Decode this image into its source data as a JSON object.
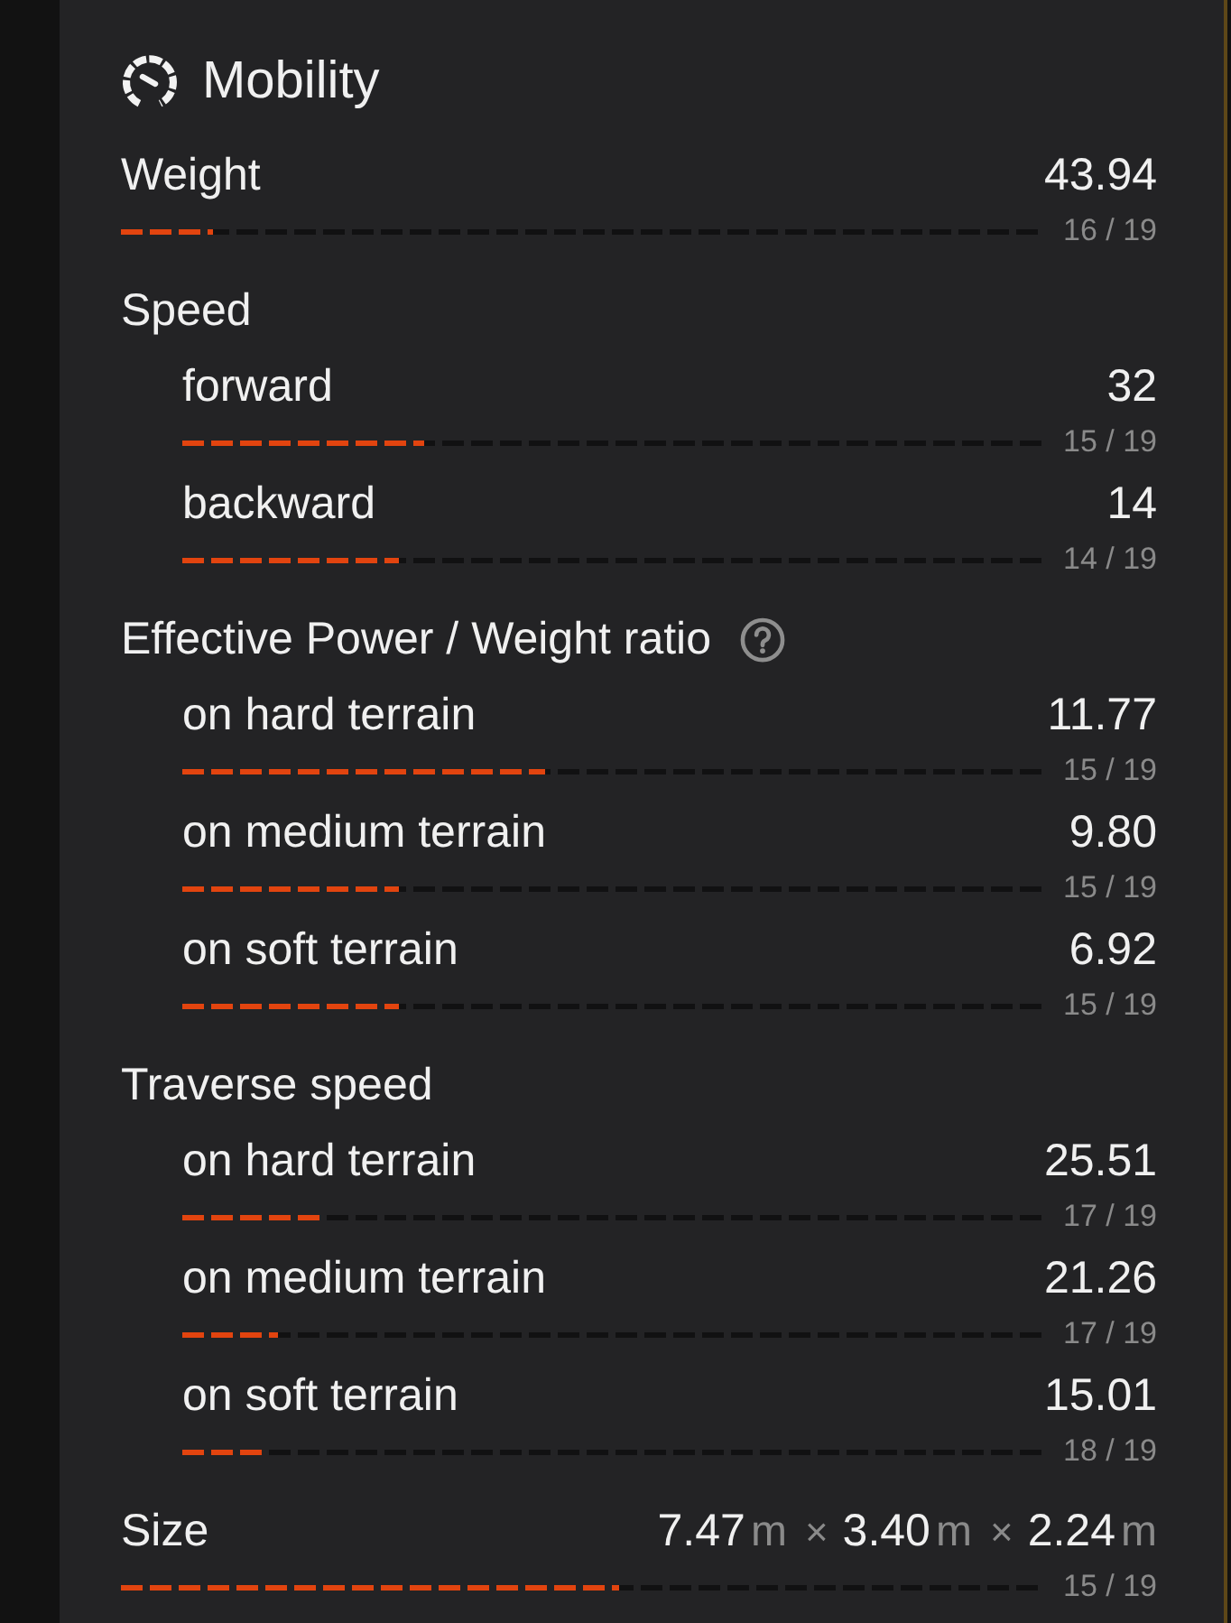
{
  "panel": {
    "title": "Mobility"
  },
  "stats": [
    {
      "kind": "stat",
      "label": "Weight",
      "value": "43.94",
      "rank": "16 / 19",
      "level": 0.1
    },
    {
      "kind": "group",
      "label": "Speed",
      "help": false,
      "children": [
        {
          "label": "forward",
          "value": "32",
          "rank": "15 / 19",
          "level": 0.28
        },
        {
          "label": "backward",
          "value": "14",
          "rank": "14 / 19",
          "level": 0.25
        }
      ]
    },
    {
      "kind": "group",
      "label": "Effective Power / Weight ratio",
      "help": true,
      "children": [
        {
          "label": "on hard terrain",
          "value": "11.77",
          "rank": "15 / 19",
          "level": 0.42
        },
        {
          "label": "on medium terrain",
          "value": "9.80",
          "rank": "15 / 19",
          "level": 0.25
        },
        {
          "label": "on soft terrain",
          "value": "6.92",
          "rank": "15 / 19",
          "level": 0.25
        }
      ]
    },
    {
      "kind": "group",
      "label": "Traverse speed",
      "help": false,
      "children": [
        {
          "label": "on hard terrain",
          "value": "25.51",
          "rank": "17 / 19",
          "level": 0.16
        },
        {
          "label": "on medium terrain",
          "value": "21.26",
          "rank": "17 / 19",
          "level": 0.11
        },
        {
          "label": "on soft terrain",
          "value": "15.01",
          "rank": "18 / 19",
          "level": 0.1
        }
      ]
    },
    {
      "kind": "size",
      "label": "Size",
      "dims": [
        {
          "value": "7.47",
          "unit": "m"
        },
        {
          "separator": "×",
          "value": "3.40",
          "unit": "m"
        },
        {
          "separator": "×",
          "value": "2.24",
          "unit": "m"
        }
      ],
      "rank": "15 / 19",
      "level": 0.54
    }
  ]
}
